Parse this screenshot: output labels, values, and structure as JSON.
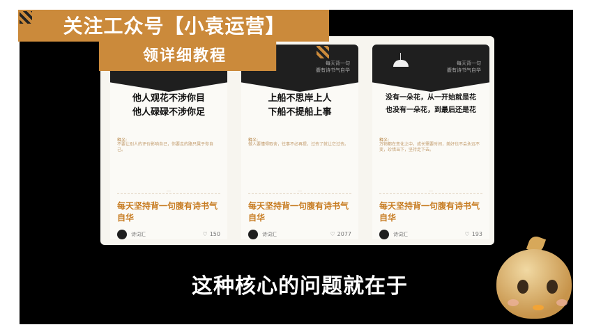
{
  "overlay": {
    "banner_line1": "关注工众号【小袁运营】",
    "banner_line2": "领详细教程"
  },
  "subtitle": "这种核心的问题就在于",
  "cards": [
    {
      "top_text": "",
      "title": "他人观花不涉你目\n他人碌碌不涉你足",
      "note_label": "释义:",
      "note": "不要让别人的评价影响自己，你要走的路只属于你自己。",
      "dots": "…",
      "caption": "每天坚持背一句腹有诗书气自华",
      "author": "诗词汇",
      "likes": "150"
    },
    {
      "top_text": "每天背一句\n腹有诗书气自华",
      "title": "上船不思岸上人\n下船不提船上事",
      "note_label": "释义:",
      "note": "做人要懂得取舍，往事不必再提，过去了就让它过去。",
      "dots": "…",
      "caption": "每天坚持背一句腹有诗书气自华",
      "author": "诗词汇",
      "likes": "2077"
    },
    {
      "top_text": "每天背一句\n腹有诗书气自华",
      "title": "没有一朵花，从一开始就是花\n也没有一朵花，到最后还是花",
      "note_label": "释义:",
      "note": "万物都在变化之中，成长需要时间，美好也不会永远不变，珍惜当下，坚持走下去。",
      "dots": "…",
      "caption": "每天坚持背一句腹有诗书气自华",
      "author": "诗词汇",
      "likes": "193"
    }
  ],
  "icons": {
    "heart": "heart-icon",
    "lamp": "lamp-icon"
  },
  "colors": {
    "banner": "#cb8a3b",
    "caption": "#c77c22"
  }
}
